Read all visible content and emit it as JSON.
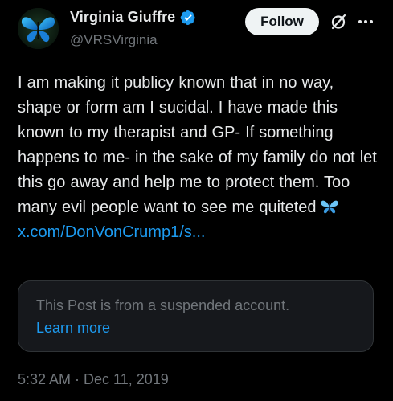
{
  "author": {
    "display_name": "Virginia Giuffre",
    "handle": "@VRSVirginia",
    "verified": true,
    "avatar_icon": "blue-butterfly-avatar"
  },
  "header": {
    "follow_label": "Follow",
    "grok_icon": "grok-slash-icon",
    "more_icon": "more-dots-icon"
  },
  "tweet": {
    "text": "I am making it publicy known that in no way, shape or form am I sucidal. I have made this known to my therapist and GP- If something happens to me- in the sake of my family do not let this go away and help me to protect them. Too many evil people want to see me quiteted",
    "emoji": "butterfly-emoji",
    "link": "x.com/DonVonCrump1/s..."
  },
  "quoted_card": {
    "message": "This Post is from a suspended account.",
    "learn_more_label": "Learn more"
  },
  "timestamp": "5:32 AM · Dec 11, 2019",
  "colors": {
    "background": "#000000",
    "text": "#e7e9ea",
    "muted": "#71767b",
    "accent": "#1d9bf0",
    "card_bg": "#16181c",
    "card_border": "#2f3336",
    "follow_bg": "#eff3f4"
  }
}
